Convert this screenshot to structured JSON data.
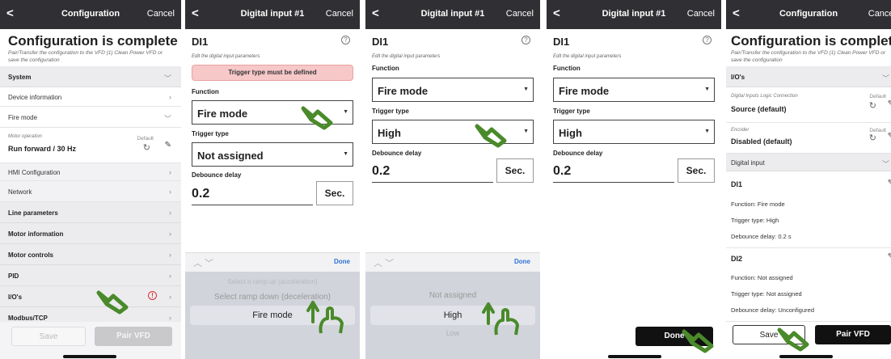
{
  "panel1": {
    "topbar": {
      "back": "<",
      "title": "Configuration",
      "cancel": "Cancel"
    },
    "heading": "Configuration is complete",
    "subtitle": "Pair/Transfer the configuration to the VFD (1) Clean Power VFD or save the configuration",
    "rows": {
      "system": "System",
      "device_information": "Device information",
      "fire_mode": "Fire mode",
      "motor_operation_caption": "Motor operation",
      "motor_operation_value": "Run forward / 30 Hz",
      "default": "Default",
      "hmi_configuration": "HMI Configuration",
      "network": "Network",
      "line_parameters": "Line parameters",
      "motor_information": "Motor information",
      "motor_controls": "Motor controls",
      "pid": "PID",
      "ios": "I/O's",
      "modbus_tcp": "Modbus/TCP"
    },
    "save_label": "Save",
    "pair_label": "Pair VFD"
  },
  "panel2": {
    "topbar": {
      "back": "<",
      "title": "Digital input #1",
      "cancel": "Cancel"
    },
    "heading": "DI1",
    "help": "?",
    "caption": "Edit the digital input parameters",
    "error": "Trigger type must be defined",
    "function_label": "Function",
    "function_value": "Fire mode",
    "trigger_label": "Trigger type",
    "trigger_value": "Not assigned",
    "debounce_label": "Debounce delay",
    "debounce_value": "0.2",
    "unit": "Sec.",
    "done": "Done",
    "picker_options": [
      "Select a ramp up (acceleration)",
      "Select ramp down (deceleration)",
      "Fire mode"
    ]
  },
  "panel3": {
    "topbar": {
      "back": "<",
      "title": "Digital input #1",
      "cancel": "Cancel"
    },
    "heading": "DI1",
    "help": "?",
    "caption": "Edit the digital input parameters",
    "function_label": "Function",
    "function_value": "Fire mode",
    "trigger_label": "Trigger type",
    "trigger_value": "High",
    "debounce_label": "Debounce delay",
    "debounce_value": "0.2",
    "unit": "Sec.",
    "done": "Done",
    "picker_options": [
      "Not assigned",
      "High",
      "Low"
    ]
  },
  "panel4": {
    "topbar": {
      "back": "<",
      "title": "Digital input #1",
      "cancel": "Cancel"
    },
    "heading": "DI1",
    "help": "?",
    "caption": "Edit the digital input parameters",
    "function_label": "Function",
    "function_value": "Fire mode",
    "trigger_label": "Trigger type",
    "trigger_value": "High",
    "debounce_label": "Debounce delay",
    "debounce_value": "0.2",
    "unit": "Sec.",
    "done": "Done"
  },
  "panel5": {
    "topbar": {
      "back": "<",
      "title": "Configuration",
      "cancel": "Cancel"
    },
    "heading": "Configuration is complete",
    "subtitle": "Pair/Transfer the configuration to the VFD (1) Clean Power VFD or save the configuration",
    "ios": "I/O's",
    "dilc_caption": "Digital Inputs Logic Connection",
    "dilc_value": "Source (default)",
    "encoder_caption": "Encoder",
    "encoder_value": "Disabled (default)",
    "default": "Default",
    "digital_input": "Digital input",
    "di1": "DI1",
    "di1_function": "Function: Fire mode",
    "di1_trigger": "Trigger type: High",
    "di1_debounce": "Debounce delay: 0.2 s",
    "di2": "DI2",
    "di2_function": "Function: Not assigned",
    "di2_trigger": "Trigger type: Not assigned",
    "di2_debounce": "Debounce delay: Unconfigured",
    "save_label": "Save",
    "pair_label": "Pair VFD"
  },
  "colors": {
    "topbar": "#303034",
    "accent_blue": "#2f72d6",
    "gesture_green": "#4a8a2a",
    "error_bg": "#f7c8c8",
    "alert_red": "#d83030"
  },
  "icons": [
    "back-chevron-icon",
    "chevron-right-icon",
    "chevron-down-icon",
    "reset-icon",
    "pencil-icon",
    "help-icon",
    "alert-icon",
    "tap-hand-icon",
    "swipe-up-hand-icon",
    "caret-down-icon"
  ]
}
